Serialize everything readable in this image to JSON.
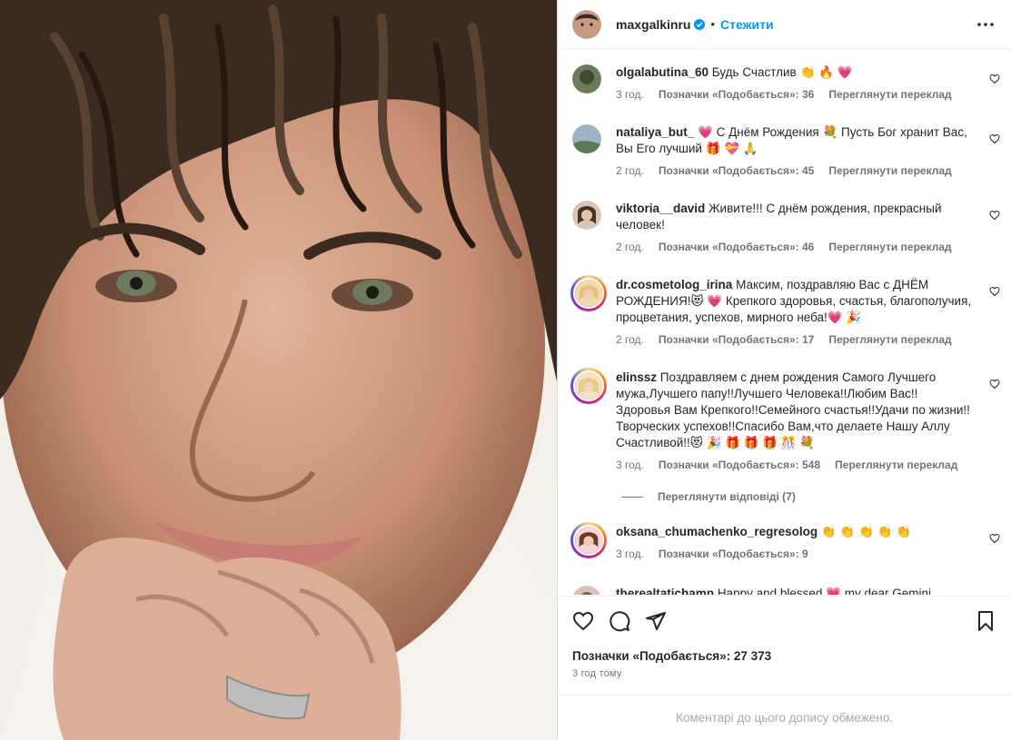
{
  "post": {
    "author": "maxgalkinru",
    "separator": "•",
    "follow_label": "Стежити",
    "likes_label": "Позначки «Подобається»: 27 373",
    "time_ago": "3 год тому",
    "comments_limited": "Коментарі до цього допису обмежено."
  },
  "comments": [
    {
      "user": "olgalabutina_60",
      "text": "Будь Счастлив 👏 🔥 💗",
      "time": "3 год.",
      "likes": "Позначки «Подобається»: 36",
      "translate": "Переглянути переклад"
    },
    {
      "user": "nataliya_but_",
      "text": "💗 С Днём Рождения 💐 Пусть Бог хранит Вас, Вы Его лучший 🎁 💝 🙏",
      "time": "2 год.",
      "likes": "Позначки «Подобається»: 45",
      "translate": "Переглянути переклад"
    },
    {
      "user": "viktoria__david",
      "text": "Живите!!! С днём рождения, прекрасный человек!",
      "time": "2 год.",
      "likes": "Позначки «Подобається»: 46",
      "translate": "Переглянути переклад"
    },
    {
      "user": "dr.cosmetolog_irina",
      "text": "Максим, поздравляю Вас с ДНЁМ РОЖДЕНИЯ!😻 💗 Крепкого здоровья, счастья, благополучия, процветания, успехов, мирного неба!💗 🎉",
      "time": "2 год.",
      "likes": "Позначки «Подобається»: 17",
      "translate": "Переглянути переклад"
    },
    {
      "user": "elinssz",
      "text": "Поздравляем с днем рождения Самого Лучшего мужа,Лучшего папу!!Лучшего Человека!!Любим Вас!! Здоровья Вам Крепкого!!Семейного счастья!!Удачи по жизни!!Творческих успехов!!Спасибо Вам,что делаете Нашу Аллу Счастливой!!😻 🎉 🎁 🎁 🎁 🎊 💐",
      "time": "3 год.",
      "likes": "Позначки «Подобається»: 548",
      "translate": "Переглянути переклад"
    },
    {
      "user": "oksana_chumachenko_regresolog",
      "text": "👏 👏 👏 👏 👏",
      "time": "3 год.",
      "likes": "Позначки «Подобається»: 9",
      "translate": ""
    },
    {
      "user": "therealtatichamp",
      "text": "Happy and blessed 💗 my dear Gemini",
      "time": "",
      "likes": "",
      "translate": ""
    }
  ],
  "replies_label": "Переглянути відповіді (7)",
  "icons": {
    "more": "more-horizontal-icon",
    "like": "heart-icon",
    "comment": "comment-icon",
    "share": "share-icon",
    "save": "bookmark-icon",
    "verified": "verified-badge-icon"
  },
  "colors": {
    "accent": "#0095f6",
    "muted": "#737373",
    "text": "#262626",
    "border": "#dbdbdb"
  }
}
